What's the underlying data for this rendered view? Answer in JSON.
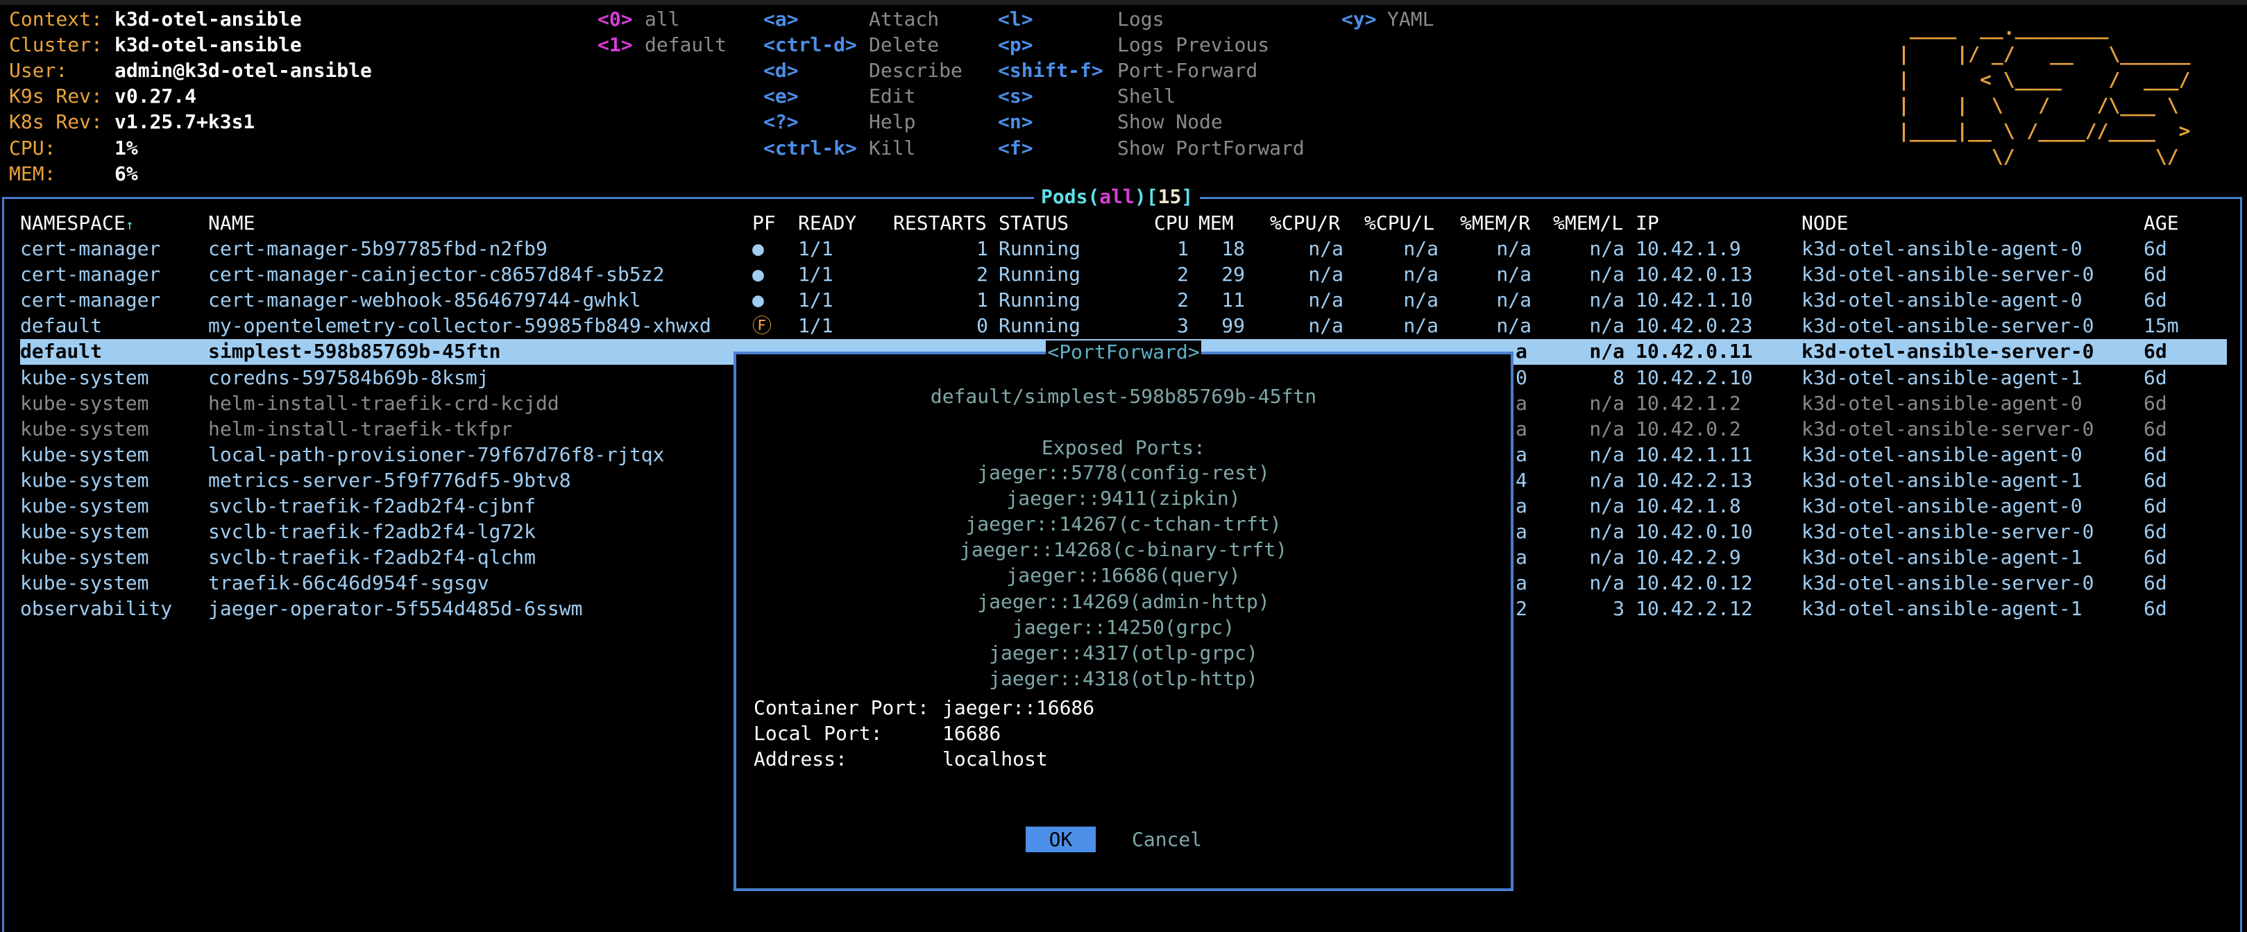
{
  "header": {
    "info": [
      {
        "label": "Context:",
        "value": "k3d-otel-ansible"
      },
      {
        "label": "Cluster:",
        "value": "k3d-otel-ansible"
      },
      {
        "label": "User:",
        "value": "admin@k3d-otel-ansible"
      },
      {
        "label": "K9s Rev:",
        "value": "v0.27.4"
      },
      {
        "label": "K8s Rev:",
        "value": "v1.25.7+k3s1"
      },
      {
        "label": "CPU:",
        "value": "1%"
      },
      {
        "label": "MEM:",
        "value": "6%"
      }
    ],
    "namespaces": [
      {
        "key": "<0>",
        "label": "all"
      },
      {
        "key": "<1>",
        "label": "default"
      }
    ],
    "shortcuts_col1": [
      {
        "key": "<a>",
        "label": "Attach"
      },
      {
        "key": "<ctrl-d>",
        "label": "Delete"
      },
      {
        "key": "<d>",
        "label": "Describe"
      },
      {
        "key": "<e>",
        "label": "Edit"
      },
      {
        "key": "<?>",
        "label": "Help"
      },
      {
        "key": "<ctrl-k>",
        "label": "Kill"
      }
    ],
    "shortcuts_col2": [
      {
        "key": "<l>",
        "label": "Logs"
      },
      {
        "key": "<p>",
        "label": "Logs Previous"
      },
      {
        "key": "<shift-f>",
        "label": "Port-Forward"
      },
      {
        "key": "<s>",
        "label": "Shell"
      },
      {
        "key": "<n>",
        "label": "Show Node"
      },
      {
        "key": "<f>",
        "label": "Show PortForward"
      }
    ],
    "shortcuts_col3": [
      {
        "key": "<y>",
        "label": "YAML"
      }
    ],
    "logo_lines": [
      " ____  __.________       ",
      "|    |/ _/   __   \\______",
      "|      < \\____    /  ___/",
      "|    |  \\   /    /\\___ \\ ",
      "|____|__ \\ /____//____  >",
      "        \\/            \\/ "
    ]
  },
  "table": {
    "title": {
      "resource": "Pods",
      "open": "(",
      "namespace": "all",
      "close": ")",
      "count_open": "[",
      "count": "15",
      "count_close": "]"
    },
    "columns": [
      "NAMESPACE",
      "NAME",
      "PF",
      "READY",
      "RESTARTS",
      "STATUS",
      "CPU",
      "MEM",
      "%CPU/R",
      "%CPU/L",
      "%MEM/R",
      "%MEM/L",
      "IP",
      "NODE",
      "AGE"
    ],
    "sort_indicator": "↑",
    "selected_index": 4,
    "rows": [
      {
        "namespace": "cert-manager",
        "name": "cert-manager-5b97785fbd-n2fb9",
        "pf": "●",
        "ready": "1/1",
        "restarts": "1",
        "status": "Running",
        "cpu": "1",
        "mem": "18",
        "cpu_r": "n/a",
        "cpu_l": "n/a",
        "mem_r": "n/a",
        "mem_l": "n/a",
        "ip": "10.42.1.9",
        "node": "k3d-otel-ansible-agent-0",
        "age": "6d",
        "dim": false
      },
      {
        "namespace": "cert-manager",
        "name": "cert-manager-cainjector-c8657d84f-sb5z2",
        "pf": "●",
        "ready": "1/1",
        "restarts": "2",
        "status": "Running",
        "cpu": "2",
        "mem": "29",
        "cpu_r": "n/a",
        "cpu_l": "n/a",
        "mem_r": "n/a",
        "mem_l": "n/a",
        "ip": "10.42.0.13",
        "node": "k3d-otel-ansible-server-0",
        "age": "6d",
        "dim": false
      },
      {
        "namespace": "cert-manager",
        "name": "cert-manager-webhook-8564679744-gwhkl",
        "pf": "●",
        "ready": "1/1",
        "restarts": "1",
        "status": "Running",
        "cpu": "2",
        "mem": "11",
        "cpu_r": "n/a",
        "cpu_l": "n/a",
        "mem_r": "n/a",
        "mem_l": "n/a",
        "ip": "10.42.1.10",
        "node": "k3d-otel-ansible-agent-0",
        "age": "6d",
        "dim": false
      },
      {
        "namespace": "default",
        "name": "my-opentelemetry-collector-59985fb849-xhwxd",
        "pf": "Ⓕ",
        "ready": "1/1",
        "restarts": "0",
        "status": "Running",
        "cpu": "3",
        "mem": "99",
        "cpu_r": "n/a",
        "cpu_l": "n/a",
        "mem_r": "n/a",
        "mem_l": "n/a",
        "ip": "10.42.0.23",
        "node": "k3d-otel-ansible-server-0",
        "age": "15m",
        "dim": false
      },
      {
        "namespace": "default",
        "name": "simplest-598b85769b-45ftn",
        "mem_r_tail": "a",
        "mem_l": "n/a",
        "ip": "10.42.0.11",
        "node": "k3d-otel-ansible-server-0",
        "age": "6d",
        "dim": false
      },
      {
        "namespace": "kube-system",
        "name": "coredns-597584b69b-8ksmj",
        "mem_r_tail": "0",
        "mem_l": "8",
        "ip": "10.42.2.10",
        "node": "k3d-otel-ansible-agent-1",
        "age": "6d",
        "dim": false
      },
      {
        "namespace": "kube-system",
        "name": "helm-install-traefik-crd-kcjdd",
        "mem_r_tail": "a",
        "mem_l": "n/a",
        "ip": "10.42.1.2",
        "node": "k3d-otel-ansible-agent-0",
        "age": "6d",
        "dim": true
      },
      {
        "namespace": "kube-system",
        "name": "helm-install-traefik-tkfpr",
        "mem_r_tail": "a",
        "mem_l": "n/a",
        "ip": "10.42.0.2",
        "node": "k3d-otel-ansible-server-0",
        "age": "6d",
        "dim": true
      },
      {
        "namespace": "kube-system",
        "name": "local-path-provisioner-79f67d76f8-rjtqx",
        "mem_r_tail": "a",
        "mem_l": "n/a",
        "ip": "10.42.1.11",
        "node": "k3d-otel-ansible-agent-0",
        "age": "6d",
        "dim": false
      },
      {
        "namespace": "kube-system",
        "name": "metrics-server-5f9f776df5-9btv8",
        "mem_r_tail": "4",
        "mem_l": "n/a",
        "ip": "10.42.2.13",
        "node": "k3d-otel-ansible-agent-1",
        "age": "6d",
        "dim": false
      },
      {
        "namespace": "kube-system",
        "name": "svclb-traefik-f2adb2f4-cjbnf",
        "mem_r_tail": "a",
        "mem_l": "n/a",
        "ip": "10.42.1.8",
        "node": "k3d-otel-ansible-agent-0",
        "age": "6d",
        "dim": false
      },
      {
        "namespace": "kube-system",
        "name": "svclb-traefik-f2adb2f4-lg72k",
        "mem_r_tail": "a",
        "mem_l": "n/a",
        "ip": "10.42.0.10",
        "node": "k3d-otel-ansible-server-0",
        "age": "6d",
        "dim": false
      },
      {
        "namespace": "kube-system",
        "name": "svclb-traefik-f2adb2f4-qlchm",
        "mem_r_tail": "a",
        "mem_l": "n/a",
        "ip": "10.42.2.9",
        "node": "k3d-otel-ansible-agent-1",
        "age": "6d",
        "dim": false
      },
      {
        "namespace": "kube-system",
        "name": "traefik-66c46d954f-sgsgv",
        "mem_r_tail": "a",
        "mem_l": "n/a",
        "ip": "10.42.0.12",
        "node": "k3d-otel-ansible-server-0",
        "age": "6d",
        "dim": false
      },
      {
        "namespace": "observability",
        "name": "jaeger-operator-5f554d485d-6sswm",
        "mem_r_tail": "2",
        "mem_l": "3",
        "ip": "10.42.2.12",
        "node": "k3d-otel-ansible-agent-1",
        "age": "6d",
        "dim": false
      }
    ]
  },
  "dialog": {
    "title": "<PortForward>",
    "target": "default/simplest-598b85769b-45ftn",
    "exposed_label": "Exposed Ports:",
    "ports": [
      "jaeger::5778(config-rest)",
      "jaeger::9411(zipkin)",
      "jaeger::14267(c-tchan-trft)",
      "jaeger::14268(c-binary-trft)",
      "jaeger::16686(query)",
      "jaeger::14269(admin-http)",
      "jaeger::14250(grpc)",
      "jaeger::4317(otlp-grpc)",
      "jaeger::4318(otlp-http)"
    ],
    "fields": [
      {
        "label": "Container Port:",
        "value": "jaeger::16686"
      },
      {
        "label": "Local Port:",
        "value": "16686"
      },
      {
        "label": "Address:",
        "value": "localhost"
      }
    ],
    "ok_label": "OK",
    "cancel_label": "Cancel"
  }
}
